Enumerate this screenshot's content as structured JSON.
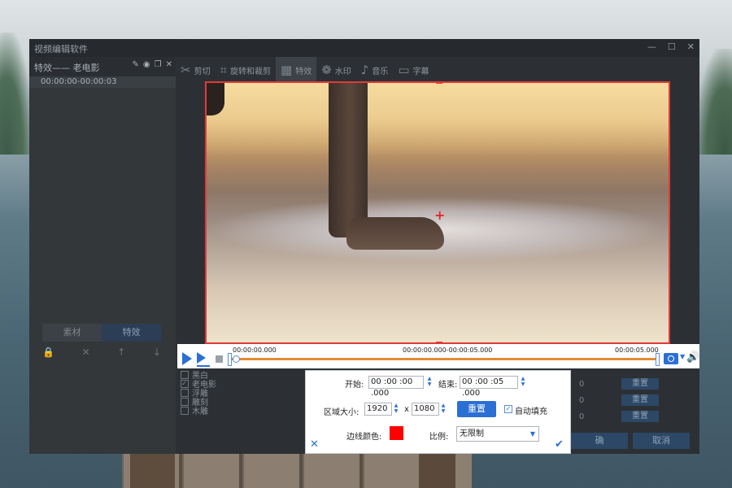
{
  "window": {
    "title": "视频编辑软件"
  },
  "left": {
    "effect_name": "特效—— 老电影",
    "effect_time": "00:00:00-00:00:03",
    "tabs": [
      "素材",
      "特效"
    ],
    "active_tab": "特效"
  },
  "toolbar": {
    "items": [
      "剪切",
      "旋转和裁剪",
      "特效",
      "水印",
      "音乐",
      "字幕"
    ],
    "active": "特效"
  },
  "effects_list": [
    "黑白",
    "老电影",
    "浮雕",
    "雕刻",
    "木雕"
  ],
  "effects_checked": "老电影",
  "right_settings": {
    "values": [
      "0",
      "0",
      "0"
    ],
    "reset_label": "重置"
  },
  "dialog_buttons": {
    "ok": "确",
    "cancel": "取消"
  },
  "player": {
    "start_time": "00:00:00.000",
    "range": "00:00:00.000-00:00:05.000",
    "end_time": "00:00:05.000",
    "progress": 0.0
  },
  "popup": {
    "start_label": "开始:",
    "start_value": "00 :00 :00 .000",
    "end_label": "结束:",
    "end_value": "00 :00 :05 .000",
    "region_label": "区域大小:",
    "width": "1920",
    "height": "1080",
    "x_sep": "x",
    "reset": "重置",
    "autofill": "自动填充",
    "autofill_checked": true,
    "border_color_label": "边线颜色:",
    "border_color": "#ff0000",
    "ratio_label": "比例:",
    "ratio_value": "无限制"
  },
  "colors": {
    "accent": "#2b6fd4",
    "frame": "#e13a3a",
    "timeline": "#e58b2e"
  }
}
